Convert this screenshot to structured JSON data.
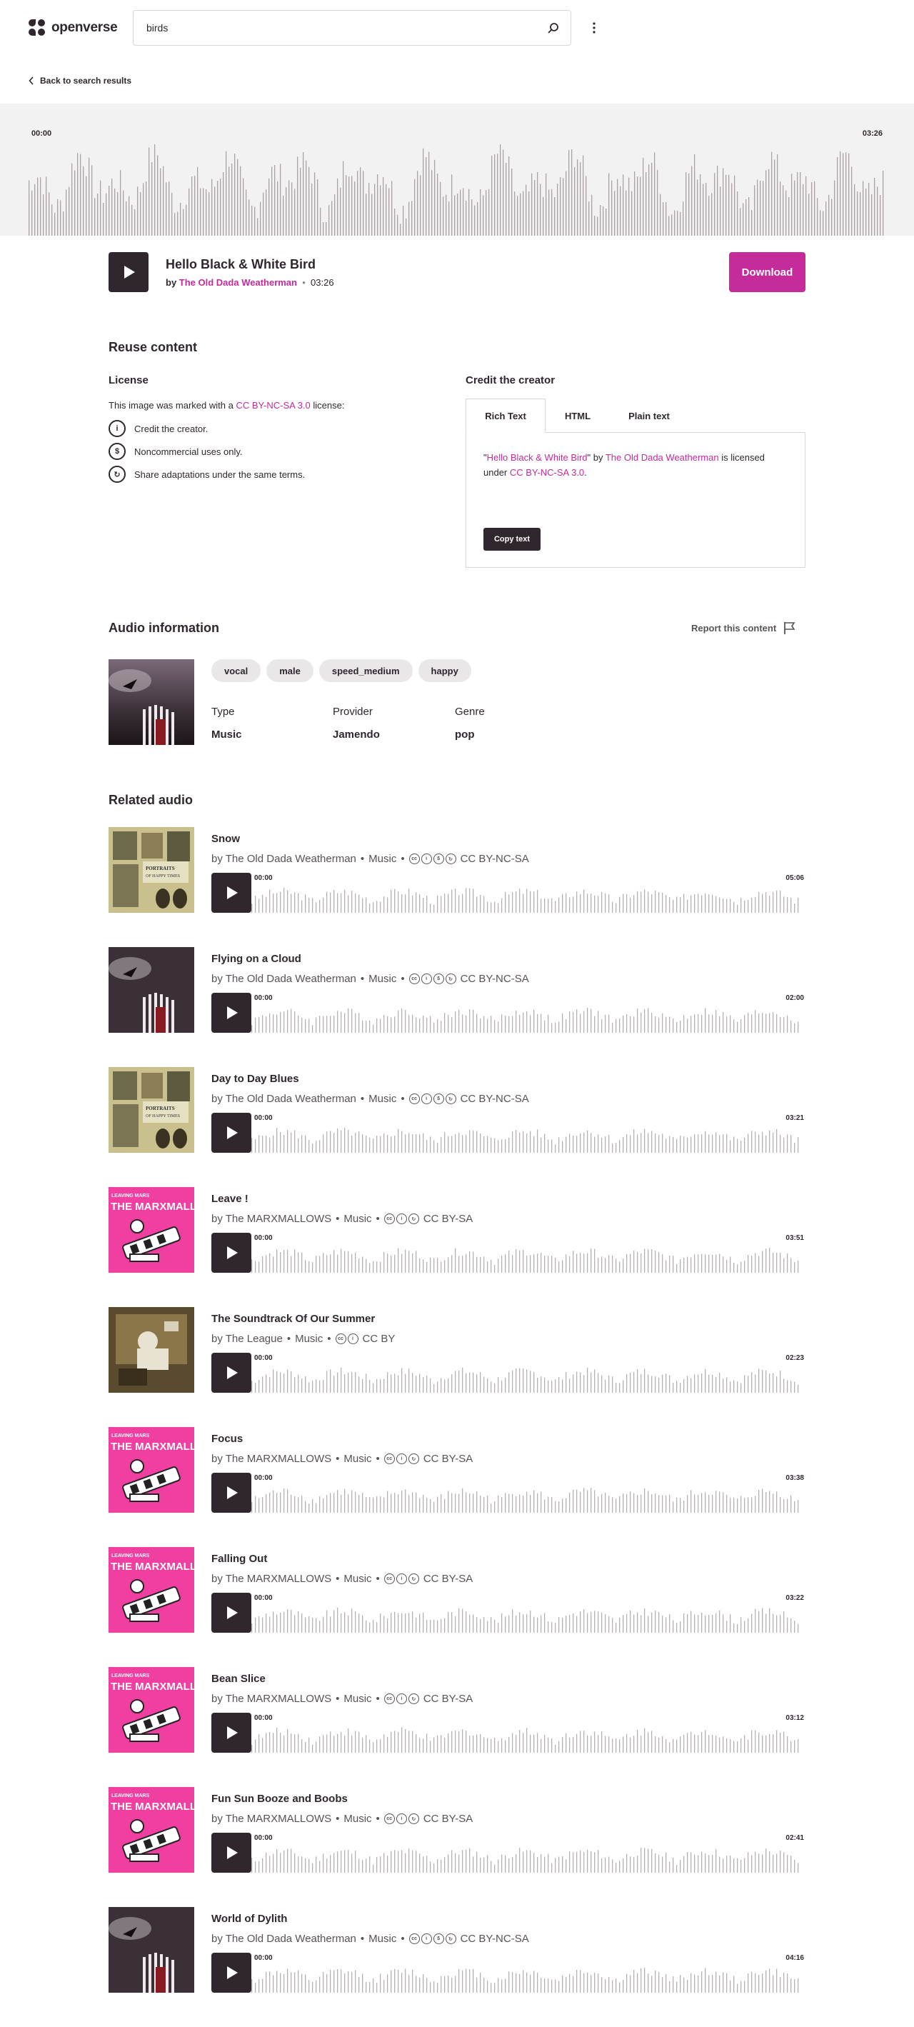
{
  "header": {
    "logo_text": "openverse",
    "search_value": "birds"
  },
  "back_link": "Back to search results",
  "player": {
    "time_start": "00:00",
    "time_end": "03:26",
    "title": "Hello Black & White Bird",
    "by": "by",
    "creator": "The Old Dada Weatherman",
    "separator": "•",
    "duration": "03:26",
    "download_label": "Download"
  },
  "reuse": {
    "heading": "Reuse content",
    "license_heading": "License",
    "license_prefix": "This image was marked with a",
    "license_link": "CC BY-NC-SA 3.0",
    "license_suffix": "license:",
    "items": [
      {
        "icon": "by-icon",
        "glyph": "i",
        "text": "Credit the creator."
      },
      {
        "icon": "nc-icon",
        "glyph": "$",
        "text": "Noncommercial uses only."
      },
      {
        "icon": "sa-icon",
        "glyph": "↻",
        "text": "Share adaptations under the same terms."
      }
    ],
    "credit_heading": "Credit the creator",
    "tabs": [
      "Rich Text",
      "HTML",
      "Plain text"
    ],
    "credit": {
      "q1": "\"",
      "title": "Hello Black & White Bird",
      "q2": "\" by ",
      "creator": "The Old Dada Weatherman",
      "mid": " is licensed under ",
      "license": "CC BY-NC-SA 3.0",
      "end": "."
    },
    "copy_label": "Copy text"
  },
  "info": {
    "heading": "Audio information",
    "report_label": "Report this content",
    "tags": [
      "vocal",
      "male",
      "speed_medium",
      "happy"
    ],
    "type_label": "Type",
    "type_value": "Music",
    "provider_label": "Provider",
    "provider_value": "Jamendo",
    "genre_label": "Genre",
    "genre_value": "pop"
  },
  "related": {
    "heading": "Related audio",
    "items": [
      {
        "title": "Snow",
        "creator": "by The Old Dada Weatherman",
        "category": "Music",
        "license": "CC BY-NC-SA",
        "icons": [
          "cc",
          "by",
          "nc",
          "sa"
        ],
        "start": "00:00",
        "end": "05:06",
        "art": "portraits"
      },
      {
        "title": "Flying on a Cloud",
        "creator": "by The Old Dada Weatherman",
        "category": "Music",
        "license": "CC BY-NC-SA",
        "icons": [
          "cc",
          "by",
          "nc",
          "sa"
        ],
        "start": "00:00",
        "end": "02:00",
        "art": "bird"
      },
      {
        "title": "Day to Day Blues",
        "creator": "by The Old Dada Weatherman",
        "category": "Music",
        "license": "CC BY-NC-SA",
        "icons": [
          "cc",
          "by",
          "nc",
          "sa"
        ],
        "start": "00:00",
        "end": "03:21",
        "art": "portraits"
      },
      {
        "title": "Leave !",
        "creator": "by The MARXMALLOWS",
        "category": "Music",
        "license": "CC BY-SA",
        "icons": [
          "cc",
          "by",
          "sa"
        ],
        "start": "00:00",
        "end": "03:51",
        "art": "marx"
      },
      {
        "title": "The Soundtrack Of Our Summer",
        "creator": "by The League",
        "category": "Music",
        "license": "CC BY",
        "icons": [
          "cc",
          "by"
        ],
        "start": "00:00",
        "end": "02:23",
        "art": "league"
      },
      {
        "title": "Focus",
        "creator": "by The MARXMALLOWS",
        "category": "Music",
        "license": "CC BY-SA",
        "icons": [
          "cc",
          "by",
          "sa"
        ],
        "start": "00:00",
        "end": "03:38",
        "art": "marx"
      },
      {
        "title": "Falling Out",
        "creator": "by The MARXMALLOWS",
        "category": "Music",
        "license": "CC BY-SA",
        "icons": [
          "cc",
          "by",
          "sa"
        ],
        "start": "00:00",
        "end": "03:22",
        "art": "marx"
      },
      {
        "title": "Bean Slice",
        "creator": "by The MARXMALLOWS",
        "category": "Music",
        "license": "CC BY-SA",
        "icons": [
          "cc",
          "by",
          "sa"
        ],
        "start": "00:00",
        "end": "03:12",
        "art": "marx"
      },
      {
        "title": "Fun Sun Booze and Boobs",
        "creator": "by The MARXMALLOWS",
        "category": "Music",
        "license": "CC BY-SA",
        "icons": [
          "cc",
          "by",
          "sa"
        ],
        "start": "00:00",
        "end": "02:41",
        "art": "marx"
      },
      {
        "title": "World of Dylith",
        "creator": "by The Old Dada Weatherman",
        "category": "Music",
        "license": "CC BY-NC-SA",
        "icons": [
          "cc",
          "by",
          "nc",
          "sa"
        ],
        "start": "00:00",
        "end": "04:16",
        "art": "bird"
      }
    ]
  },
  "art_text": {
    "portraits": "PORTRAITS OF HAPPY TIMES",
    "marx_small": "LEAVING MARS",
    "marx_big": "THE MARXMALLOWS"
  },
  "colors": {
    "accent": "#c52b9b",
    "dark": "#30272e",
    "pink_art": "#f03fa0"
  }
}
